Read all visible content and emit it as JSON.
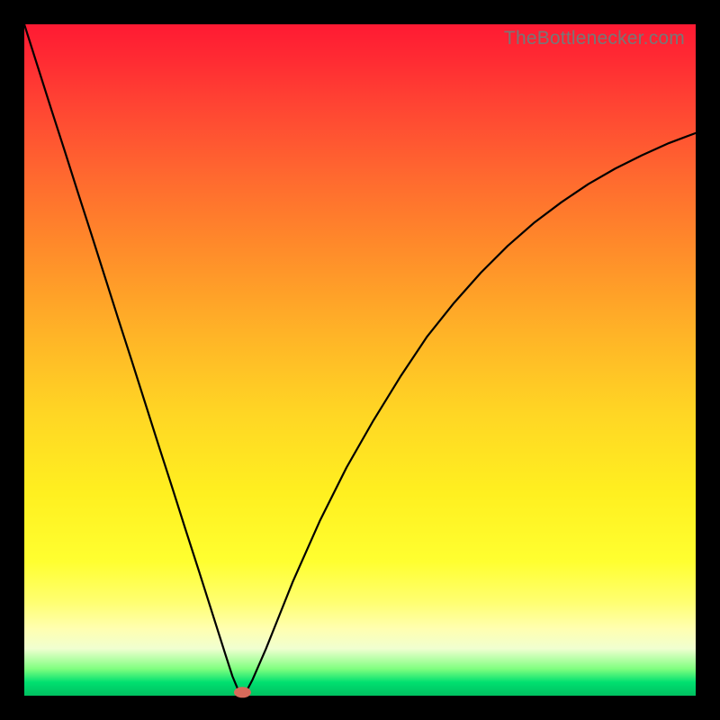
{
  "watermark": "TheBottlenecker.com",
  "chart_data": {
    "type": "line",
    "title": "",
    "xlabel": "",
    "ylabel": "",
    "xlim": [
      0,
      100
    ],
    "ylim": [
      0,
      100
    ],
    "x": [
      0,
      2,
      4,
      6,
      8,
      10,
      12,
      14,
      16,
      18,
      20,
      22,
      24,
      26,
      28,
      30,
      31,
      32,
      33,
      34,
      36,
      38,
      40,
      44,
      48,
      52,
      56,
      60,
      64,
      68,
      72,
      76,
      80,
      84,
      88,
      92,
      96,
      100
    ],
    "values": [
      100,
      93.7,
      87.4,
      81.2,
      74.9,
      68.7,
      62.4,
      56.1,
      49.9,
      43.6,
      37.3,
      31.1,
      24.8,
      18.6,
      12.3,
      6,
      2.9,
      0.5,
      0.5,
      2.4,
      7,
      12,
      17,
      26,
      34,
      41,
      47.5,
      53.5,
      58.5,
      63,
      67,
      70.5,
      73.5,
      76.2,
      78.5,
      80.5,
      82.3,
      83.8
    ],
    "annotations": [
      {
        "type": "marker",
        "x": 32.5,
        "y": 0.5,
        "label": "optimal-point"
      }
    ],
    "gradient_bands_note": "background encodes bottleneck severity: green=balanced near bottom, red=severe near top",
    "grid": false,
    "legend": false
  }
}
